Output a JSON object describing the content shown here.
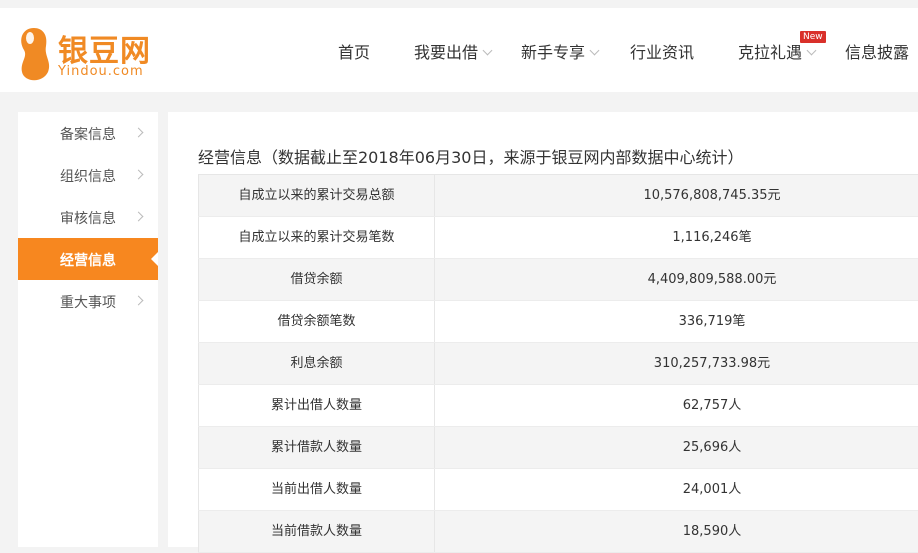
{
  "logo": {
    "name_cn": "银豆网",
    "name_en": "Yindou.com",
    "brand_color": "#f08a24"
  },
  "nav": {
    "items": [
      {
        "label": "首页",
        "has_dropdown": false
      },
      {
        "label": "我要出借",
        "has_dropdown": true
      },
      {
        "label": "新手专享",
        "has_dropdown": true
      },
      {
        "label": "行业资讯",
        "has_dropdown": false
      },
      {
        "label": "克拉礼遇",
        "has_dropdown": true,
        "badge": "New"
      },
      {
        "label": "信息披露",
        "has_dropdown": false
      }
    ]
  },
  "sidebar": {
    "accent_color": "#f7871f",
    "items": [
      {
        "label": "备案信息",
        "active": false
      },
      {
        "label": "组织信息",
        "active": false
      },
      {
        "label": "审核信息",
        "active": false
      },
      {
        "label": "经营信息",
        "active": true
      },
      {
        "label": "重大事项",
        "active": false
      }
    ]
  },
  "main": {
    "title": "经营信息（数据截止至2018年06月30日，来源于银豆网内部数据中心统计）",
    "rows": [
      {
        "label": "自成立以来的累计交易总额",
        "value": "10,576,808,745.35元"
      },
      {
        "label": "自成立以来的累计交易笔数",
        "value": "1,116,246笔"
      },
      {
        "label": "借贷余额",
        "value": "4,409,809,588.00元"
      },
      {
        "label": "借贷余额笔数",
        "value": "336,719笔"
      },
      {
        "label": "利息余额",
        "value": "310,257,733.98元"
      },
      {
        "label": "累计出借人数量",
        "value": "62,757人"
      },
      {
        "label": "累计借款人数量",
        "value": "25,696人"
      },
      {
        "label": "当前出借人数量",
        "value": "24,001人"
      },
      {
        "label": "当前借款人数量",
        "value": "18,590人"
      }
    ]
  }
}
